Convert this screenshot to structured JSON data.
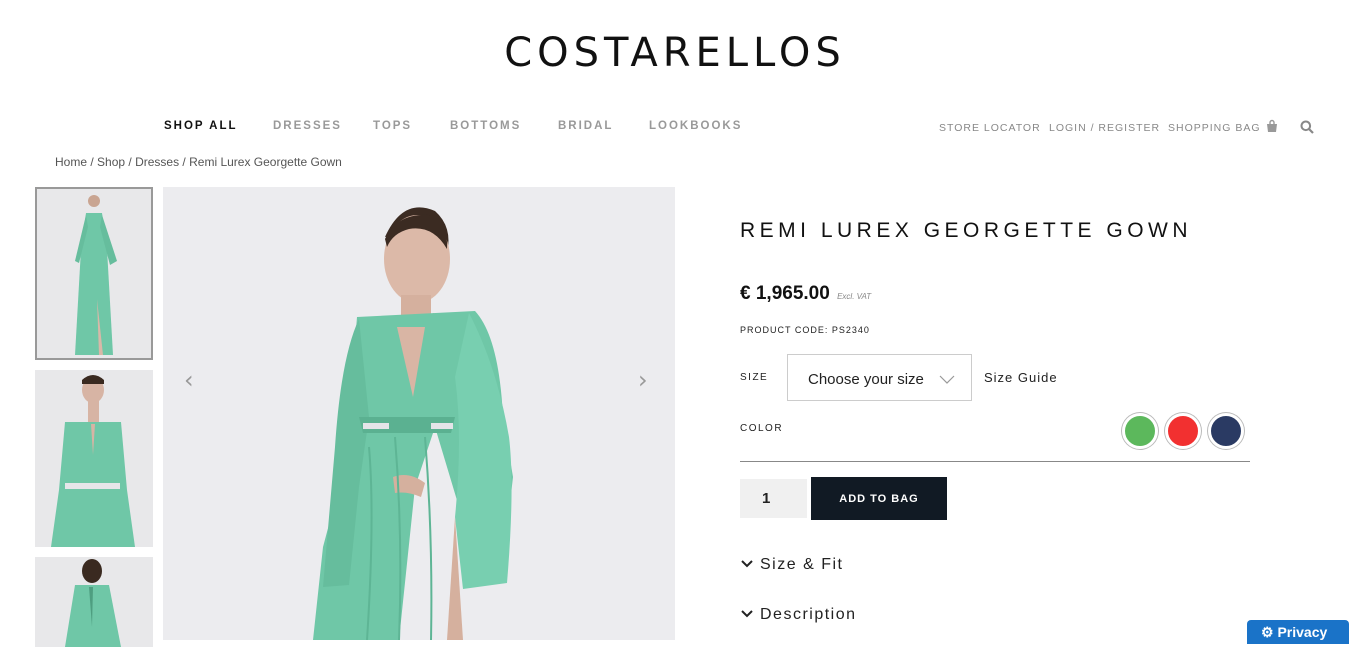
{
  "brand": {
    "logo_text": "COSTARELLOS"
  },
  "nav": {
    "items": [
      "SHOP ALL",
      "DRESSES",
      "TOPS",
      "BOTTOMS",
      "BRIDAL",
      "LOOKBOOKS"
    ],
    "active": "SHOP ALL",
    "utility": {
      "store_locator": "STORE LOCATOR",
      "login": "LOGIN / REGISTER",
      "bag": "SHOPPING BAG"
    }
  },
  "breadcrumb": {
    "home": "Home",
    "shop": "Shop",
    "dresses": "Dresses",
    "current": "Remi Lurex Georgette Gown",
    "separator": " / "
  },
  "product": {
    "title": "REMI LUREX GEORGETTE GOWN",
    "price": "€ 1,965.00",
    "vat_note": "Excl. VAT",
    "code_label": "PRODUCT CODE: PS2340",
    "size_label": "SIZE",
    "size_placeholder": "Choose your size",
    "size_guide": "Size Guide",
    "color_label": "COLOR",
    "colors": [
      "#5cb85c",
      "#f23030",
      "#2a3a63"
    ],
    "quantity": "1",
    "add_to_bag": "ADD TO BAG",
    "accordions": [
      "Size & Fit",
      "Description"
    ]
  },
  "gallery": {
    "dress_color": "#6fc7a7"
  },
  "privacy": {
    "label": "Privacy"
  }
}
